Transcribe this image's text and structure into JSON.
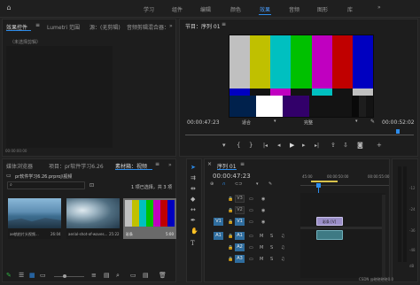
{
  "menu": {
    "items": [
      "学习",
      "组件",
      "编辑",
      "颜色",
      "效果",
      "音频",
      "图形",
      "库"
    ],
    "active_index": 4,
    "overflow_label": "»"
  },
  "source_panel": {
    "tabs": [
      "效果控件",
      "Lumetri 范围",
      "源：(无剪辑)",
      "音频剪辑混合器："
    ],
    "overflow_label": "»",
    "empty_label": "（未选择剪辑）",
    "timecode": "00:00:00:00"
  },
  "program": {
    "title": "节目：序列 01",
    "timecode_left": "00:00:47:23",
    "fit_label": "适合",
    "quality_label": "完整",
    "timecode_right": "00:00:52:02"
  },
  "project": {
    "tabs": [
      "媒体浏览器",
      "项目：pr软件学习6.26",
      "素材箱：视频"
    ],
    "overflow_label": "»",
    "path": "pr软件学习6.26.prproj\\视频",
    "selection_status": "1 项已选择，共 3 项",
    "clips": [
      {
        "name": "ae航拍片头视频...",
        "duration": "26:04"
      },
      {
        "name": "aerial-shot-of-waves...",
        "duration": "25:22"
      },
      {
        "name": "彩条",
        "duration": "5:00"
      }
    ]
  },
  "sequence": {
    "title": "序列 01",
    "timecode": "00:00:47:23",
    "ruler": [
      "45:00",
      "00:00:50:00",
      "00:00:55:00"
    ],
    "video_tracks": [
      "V3",
      "V2",
      "V1"
    ],
    "audio_tracks": [
      "A1",
      "A2",
      "A3"
    ],
    "source_tracks": [
      "V1",
      "A1"
    ],
    "clip_label": "彩条 [V]"
  },
  "audio_meter": {
    "scale": [
      "-12",
      "-24",
      "-36",
      "-48",
      "dB"
    ]
  },
  "watermark": "CSDN @晓晓晓晓0.0"
}
